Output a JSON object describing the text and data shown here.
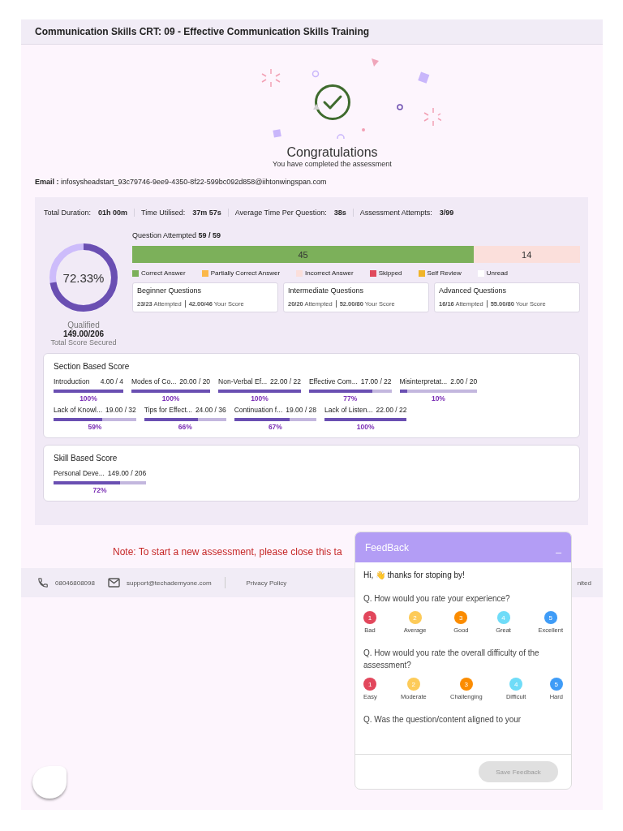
{
  "header": {
    "title": "Communication Skills CRT: 09 - Effective Communication Skills Training"
  },
  "result": {
    "heading": "Congratulations",
    "subheading": "You have completed the assessment",
    "email_label": "Email :",
    "email": "infosysheadstart_93c79746-9ee9-4350-8f22-599bc092d858@iihtonwingspan.com"
  },
  "stats": [
    {
      "label": "Total Duration:",
      "value": "01h 00m"
    },
    {
      "label": "Time Utilised:",
      "value": "37m 57s"
    },
    {
      "label": "Average Time Per Question:",
      "value": "38s"
    },
    {
      "label": "Assessment Attempts:",
      "value": "3/99"
    }
  ],
  "score": {
    "percent": "72.33%",
    "level": 0.7233,
    "status": "Qualified",
    "total": "149.00/206",
    "caption": "Total Score Secured"
  },
  "attempted": {
    "label": "Question Attempted",
    "value": "59 / 59",
    "level": 0.763,
    "segments": [
      {
        "text": "45",
        "color": "#7cb05a"
      },
      {
        "text": "14",
        "color": "#fbdfdb"
      }
    ]
  },
  "legend": [
    {
      "label": "Correct Answer",
      "color": "#7cb05a"
    },
    {
      "label": "Partially Correct Answer",
      "color": "#fbb84a"
    },
    {
      "label": "Incorrect Answer",
      "color": "#fbdfdb"
    },
    {
      "label": "Skipped",
      "color": "#e04a5c"
    },
    {
      "label": "Self Review",
      "color": "#f0b429"
    },
    {
      "label": "Unread",
      "color": "#ffffff"
    }
  ],
  "levels": [
    {
      "title": "Beginner Questions",
      "attempted": "23/23",
      "attempted_label": "Attempted",
      "score": "42.00/46",
      "score_label": "Your Score"
    },
    {
      "title": "Intermediate Questions",
      "attempted": "20/20",
      "attempted_label": "Attempted",
      "score": "52.00/80",
      "score_label": "Your Score"
    },
    {
      "title": "Advanced Questions",
      "attempted": "16/16",
      "attempted_label": "Attempted",
      "score": "55.00/80",
      "score_label": "Your Score"
    }
  ],
  "section_score": {
    "title": "Section Based Score",
    "items": [
      {
        "name": "Introduction",
        "score": "4.00 / 4",
        "level": 1,
        "percent": "100%"
      },
      {
        "name": "Modes of Co...",
        "score": "20.00 / 20",
        "level": 1,
        "percent": "100%"
      },
      {
        "name": "Non-Verbal Ef...",
        "score": "22.00 / 22",
        "level": 1,
        "percent": "100%"
      },
      {
        "name": "Effective Com...",
        "score": "17.00 / 22",
        "level": 0.77,
        "percent": "77%"
      },
      {
        "name": "Misinterpretat...",
        "score": "2.00 / 20",
        "level": 0.1,
        "percent": "10%"
      },
      {
        "name": "Lack of Knowl...",
        "score": "19.00 / 32",
        "level": 0.59,
        "percent": "59%"
      },
      {
        "name": "Tips for Effect...",
        "score": "24.00 / 36",
        "level": 0.66,
        "percent": "66%"
      },
      {
        "name": "Continuation f...",
        "score": "19.00 / 28",
        "level": 0.67,
        "percent": "67%"
      },
      {
        "name": "Lack of Listen...",
        "score": "22.00 / 22",
        "level": 1,
        "percent": "100%"
      }
    ]
  },
  "skill_score": {
    "title": "Skill Based Score",
    "items": [
      {
        "name": "Personal Deve...",
        "score": "149.00 / 206",
        "level": 0.72,
        "percent": "72%"
      }
    ]
  },
  "note": "Note: To start a new assessment, please close this ta",
  "footer": {
    "phone": "08046808098",
    "email": "support@techademyone.com",
    "privacy": "Privacy Policy",
    "copyright": "nited"
  },
  "feedback": {
    "title": "FeedBack",
    "minimize": "_",
    "greeting_before": "Hi,",
    "greeting_emoji": "👋",
    "greeting_after": "thanks for stoping by!",
    "questions": [
      {
        "text": "Q. How would you rate your experience?",
        "options": [
          {
            "number": "1",
            "label": "Bad",
            "color": "#e2475c"
          },
          {
            "number": "2",
            "label": "Average",
            "color": "#fdcb59"
          },
          {
            "number": "3",
            "label": "Good",
            "color": "#fb8c00"
          },
          {
            "number": "4",
            "label": "Great",
            "color": "#6fdcf8"
          },
          {
            "number": "5",
            "label": "Excellent",
            "color": "#3f9cf7"
          }
        ]
      },
      {
        "text": "Q. How would you rate the overall difficulty of the assessment?",
        "options": [
          {
            "number": "1",
            "label": "Easy",
            "color": "#e2475c"
          },
          {
            "number": "2",
            "label": "Moderate",
            "color": "#fdcb59"
          },
          {
            "number": "3",
            "label": "Challenging",
            "color": "#fb8c00"
          },
          {
            "number": "4",
            "label": "Difficult",
            "color": "#6fdcf8"
          },
          {
            "number": "5",
            "label": "Hard",
            "color": "#3f9cf7"
          }
        ]
      },
      {
        "text": "Q. Was the question/content aligned to your"
      }
    ],
    "save": {
      "label": "Save Feedback",
      "disabled": true
    }
  }
}
